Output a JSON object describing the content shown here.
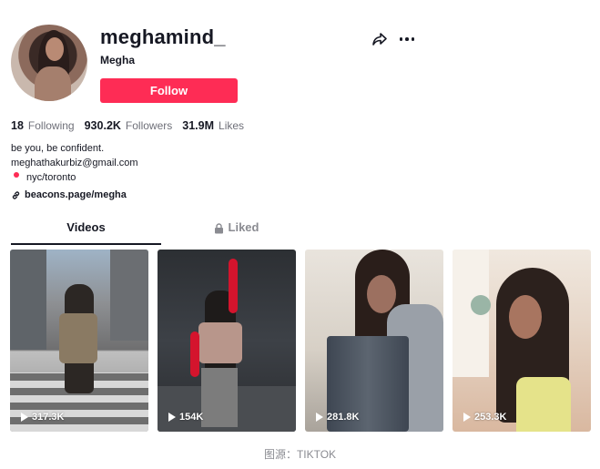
{
  "profile": {
    "username": "meghamind_",
    "nickname": "Megha",
    "follow_label": "Follow"
  },
  "stats": [
    {
      "value": "18",
      "label": "Following"
    },
    {
      "value": "930.2K",
      "label": "Followers"
    },
    {
      "value": "31.9M",
      "label": "Likes"
    }
  ],
  "bio": {
    "line1": "be you, be confident.",
    "email": "meghathakurbiz@gmail.com",
    "location": "nyc/toronto",
    "link": "beacons.page/megha"
  },
  "tabs": {
    "videos": "Videos",
    "liked": "Liked"
  },
  "videos": [
    {
      "views": "317.3K"
    },
    {
      "views": "154K"
    },
    {
      "views": "281.8K"
    },
    {
      "views": "253.3K"
    }
  ],
  "caption": "图源：TIKTOK",
  "colors": {
    "accent": "#fe2c55",
    "text": "#161823",
    "muted": "#8a8b91"
  },
  "icons": [
    "share-icon",
    "more-icon",
    "link-icon",
    "lock-icon",
    "play-icon",
    "location-pin-icon"
  ]
}
